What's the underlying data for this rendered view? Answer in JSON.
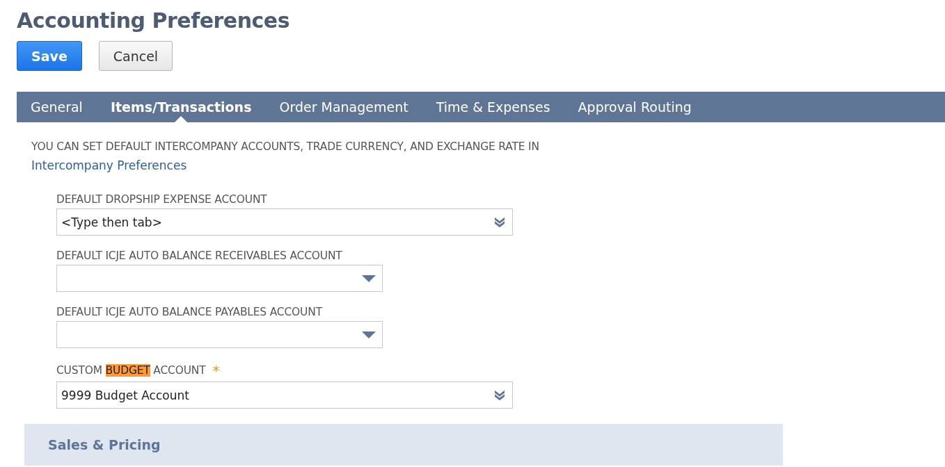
{
  "title": "Accounting Preferences",
  "buttons": [
    {
      "label": "Save",
      "kind": "primary"
    },
    {
      "label": "Cancel",
      "kind": "secondary"
    }
  ],
  "tabs": [
    {
      "label": "General",
      "selected": false
    },
    {
      "label": "Items/Transactions",
      "selected": true
    },
    {
      "label": "Order Management",
      "selected": false
    },
    {
      "label": "Time & Expenses",
      "selected": false
    },
    {
      "label": "Approval Routing",
      "selected": false
    }
  ],
  "notice": {
    "text": "YOU CAN SET DEFAULT INTERCOMPANY ACCOUNTS, TRADE CURRENCY, AND EXCHANGE RATE IN",
    "link": "Intercompany Preferences"
  },
  "fields": [
    {
      "kind": "popup",
      "label_parts": [
        {
          "text": "DEFAULT DROPSHIP EXPENSE ACCOUNT",
          "highlighted": false
        }
      ],
      "placeholder": "<Type then tab>"
    },
    {
      "kind": "select",
      "label_parts": [
        {
          "text": "DEFAULT ICJE AUTO BALANCE RECEIVABLES ACCOUNT",
          "highlighted": false
        }
      ]
    },
    {
      "kind": "select",
      "label_parts": [
        {
          "text": "DEFAULT ICJE AUTO BALANCE PAYABLES ACCOUNT",
          "highlighted": false
        }
      ]
    },
    {
      "kind": "popup",
      "label_parts": [
        {
          "text": "CUSTOM ",
          "highlighted": false
        },
        {
          "text": "BUDGET",
          "highlighted": true
        },
        {
          "text": " ACCOUNT",
          "highlighted": false
        }
      ],
      "required_mark": "*",
      "value": "9999 Budget Account"
    }
  ],
  "section": {
    "title": "Sales & Pricing"
  }
}
